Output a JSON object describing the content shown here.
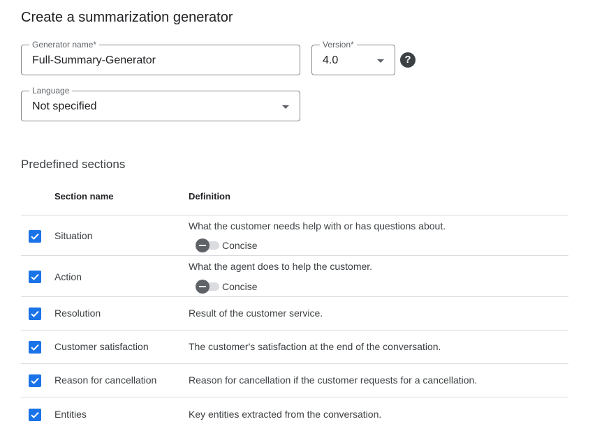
{
  "page": {
    "title": "Create a summarization generator"
  },
  "form": {
    "generator_name": {
      "label": "Generator name*",
      "value": "Full-Summary-Generator"
    },
    "version": {
      "label": "Version*",
      "value": "4.0"
    },
    "help_icon": "?",
    "language": {
      "label": "Language",
      "value": "Not specified"
    }
  },
  "sections": {
    "heading": "Predefined sections",
    "columns": {
      "name": "Section name",
      "definition": "Definition"
    },
    "rows": [
      {
        "name": "Situation",
        "definition": "What the customer needs help with or has questions about.",
        "checked": true,
        "toggle_label": "Concise",
        "toggle_on": false
      },
      {
        "name": "Action",
        "definition": "What the agent does to help the customer.",
        "checked": true,
        "toggle_label": "Concise",
        "toggle_on": false
      },
      {
        "name": "Resolution",
        "definition": "Result of the customer service.",
        "checked": true
      },
      {
        "name": "Customer satisfaction",
        "definition": "The customer's satisfaction at the end of the conversation.",
        "checked": true
      },
      {
        "name": "Reason for cancellation",
        "definition": "Reason for cancellation if the customer requests for a cancellation.",
        "checked": true
      },
      {
        "name": "Entities",
        "definition": "Key entities extracted from the conversation.",
        "checked": true
      }
    ]
  },
  "colors": {
    "accent": "#1a73e8",
    "border": "#80868b",
    "divider": "#dadce0",
    "text": "#202124"
  },
  "icons": {
    "help": "help-icon",
    "dropdown": "dropdown-arrow-icon",
    "checkbox": "checkbox-checked-icon",
    "toggle": "toggle-off-icon"
  }
}
